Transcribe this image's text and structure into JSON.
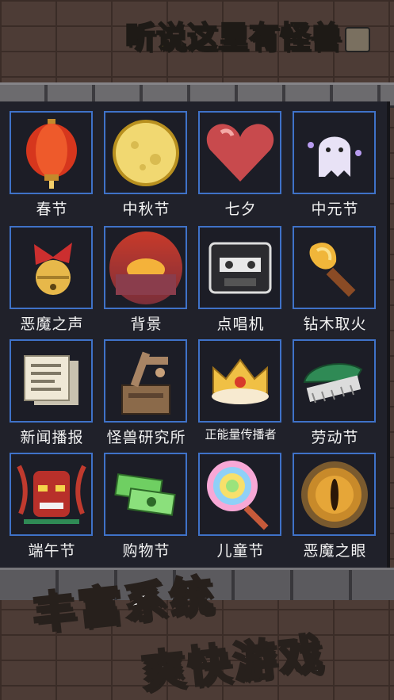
{
  "title": "听说这里有怪兽",
  "items": [
    {
      "label": "春节",
      "icon": "lantern-icon"
    },
    {
      "label": "中秋节",
      "icon": "moon-icon"
    },
    {
      "label": "七夕",
      "icon": "heart-icon"
    },
    {
      "label": "中元节",
      "icon": "ghost-icon"
    },
    {
      "label": "恶魔之声",
      "icon": "bell-bow-icon"
    },
    {
      "label": "背景",
      "icon": "sunset-icon"
    },
    {
      "label": "点唱机",
      "icon": "cassette-icon"
    },
    {
      "label": "钻木取火",
      "icon": "torch-icon"
    },
    {
      "label": "新闻播报",
      "icon": "newspaper-icon"
    },
    {
      "label": "怪兽研究所",
      "icon": "workshop-icon"
    },
    {
      "label": "正能量传播者",
      "icon": "crown-icon"
    },
    {
      "label": "劳动节",
      "icon": "brush-icon"
    },
    {
      "label": "端午节",
      "icon": "dragon-mask-icon"
    },
    {
      "label": "购物节",
      "icon": "money-icon"
    },
    {
      "label": "儿童节",
      "icon": "lollipop-icon"
    },
    {
      "label": "恶魔之眼",
      "icon": "eye-icon"
    }
  ],
  "slogan": {
    "line1": "丰富系统",
    "line2": "爽快游戏"
  }
}
